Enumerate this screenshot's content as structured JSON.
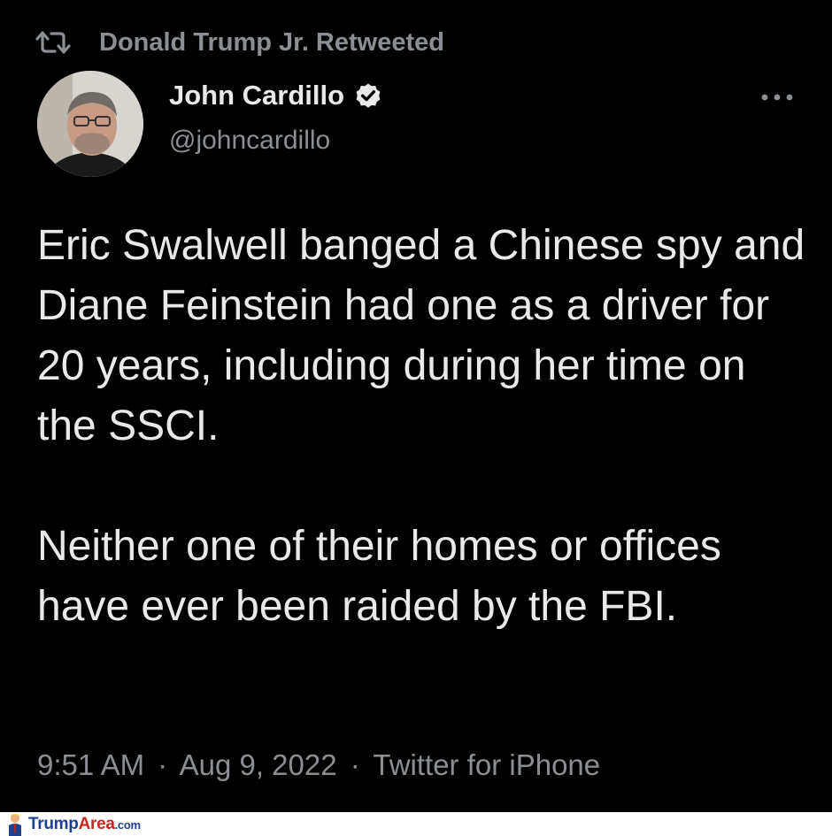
{
  "retweet": {
    "icon": "retweet-icon",
    "label": "Donald Trump Jr. Retweeted"
  },
  "author": {
    "name": "John Cardillo",
    "handle": "@johncardillo",
    "verified_icon": "verified-badge-icon"
  },
  "more_icon": "more-options-icon",
  "tweet": {
    "paragraph_1": "Eric Swalwell banged a Chinese spy and Diane Feinstein had one as a driver for 20 years, including during her time on the SSCI.",
    "paragraph_2": "Neither one of their homes or offices have ever been raided by the FBI."
  },
  "meta": {
    "time": "9:51 AM",
    "separator": "·",
    "date": "Aug 9, 2022",
    "source": "Twitter for iPhone"
  },
  "watermark": {
    "text_part_1": "Trump",
    "text_part_2": "Area",
    "text_part_3": ".com"
  },
  "colors": {
    "background": "#000000",
    "primary_text": "#e7e9ea",
    "secondary_text": "#8b8f93",
    "verified_badge": "#e7e9ea"
  }
}
